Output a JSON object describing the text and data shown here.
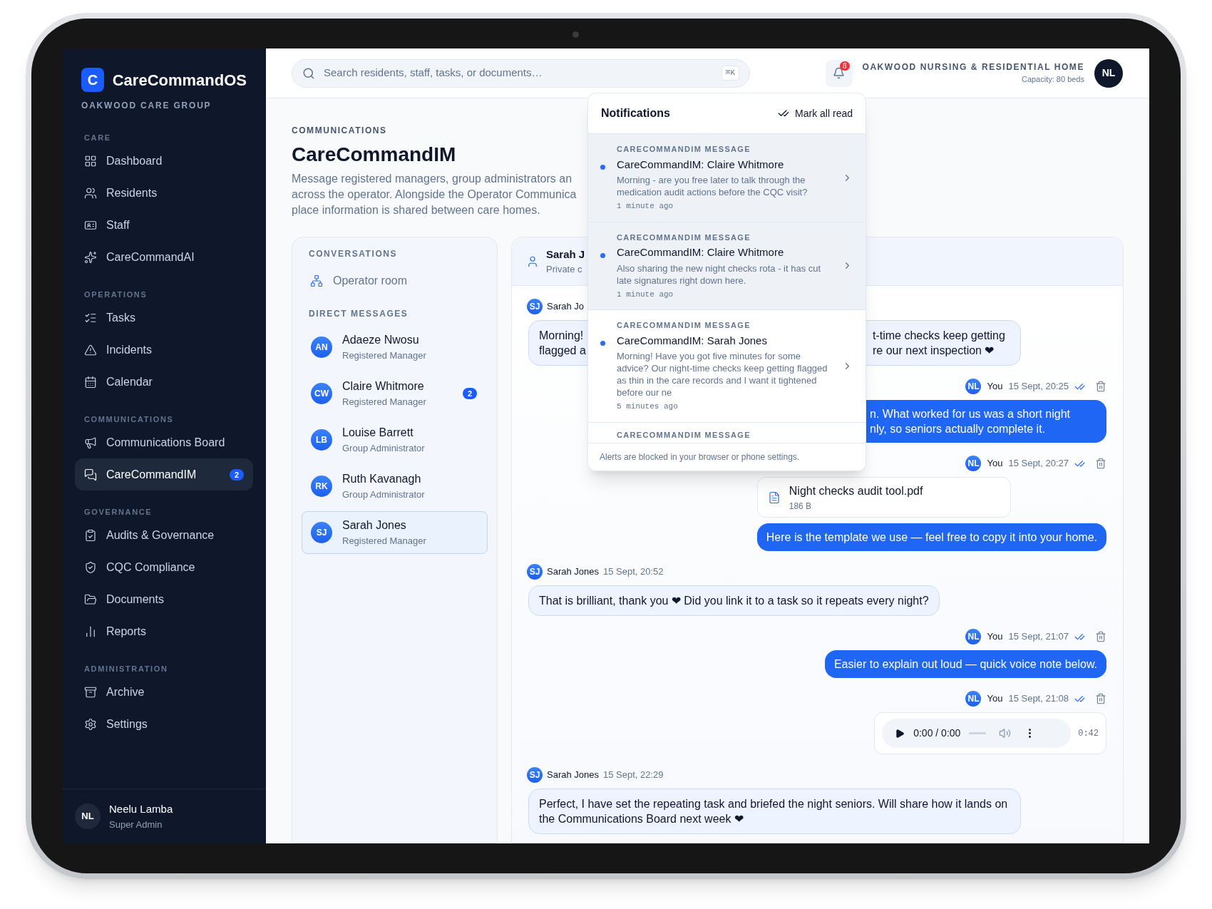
{
  "sidebar": {
    "logo_letter": "C",
    "brand": "CareCommandOS",
    "org": "OAKWOOD CARE GROUP",
    "sections": [
      {
        "title": "CARE",
        "items": [
          {
            "label": "Dashboard",
            "selected": false
          },
          {
            "label": "Residents",
            "selected": false
          },
          {
            "label": "Staff",
            "selected": false
          },
          {
            "label": "CareCommandAI",
            "selected": false
          }
        ]
      },
      {
        "title": "OPERATIONS",
        "items": [
          {
            "label": "Tasks",
            "selected": false
          },
          {
            "label": "Incidents",
            "selected": false
          },
          {
            "label": "Calendar",
            "selected": false
          }
        ]
      },
      {
        "title": "COMMUNICATIONS",
        "items": [
          {
            "label": "Communications Board",
            "selected": false
          },
          {
            "label": "CareCommandIM",
            "selected": true,
            "badge": "2"
          }
        ]
      },
      {
        "title": "GOVERNANCE",
        "items": [
          {
            "label": "Audits & Governance",
            "selected": false
          },
          {
            "label": "CQC Compliance",
            "selected": false
          },
          {
            "label": "Documents",
            "selected": false
          },
          {
            "label": "Reports",
            "selected": false
          }
        ]
      },
      {
        "title": "ADMINISTRATION",
        "items": [
          {
            "label": "Archive",
            "selected": false
          },
          {
            "label": "Settings",
            "selected": false
          }
        ]
      }
    ],
    "user": {
      "initials": "NL",
      "name": "Neelu Lamba",
      "role": "Super Admin"
    }
  },
  "topbar": {
    "search": {
      "placeholder": "Search residents, staff, tasks, or documents…",
      "shortcut": "⌘K"
    },
    "notification_count": "8",
    "home_name": "OAKWOOD NURSING & RESIDENTIAL HOME",
    "capacity": "Capacity: 80 beds",
    "avatar": "NL"
  },
  "page": {
    "breadcrumb": "COMMUNICATIONS",
    "title": "CareCommandIM",
    "description": "Message registered managers, group administrators an\nacross the operator. Alongside the Operator Communica\nplace information is shared between care homes."
  },
  "conversations": {
    "title": "CONVERSATIONS",
    "rooms": [
      {
        "label": "Operator room",
        "selected": false
      }
    ],
    "dm_title": "DIRECT MESSAGES",
    "contacts": [
      {
        "initials": "AN",
        "name": "Adaeze Nwosu",
        "role": "Registered Manager",
        "selected": false
      },
      {
        "initials": "CW",
        "name": "Claire Whitmore",
        "role": "Registered Manager",
        "selected": false,
        "badge": "2"
      },
      {
        "initials": "LB",
        "name": "Louise Barrett",
        "role": "Group Administrator",
        "selected": false
      },
      {
        "initials": "RK",
        "name": "Ruth Kavanagh",
        "role": "Group Administrator",
        "selected": false
      },
      {
        "initials": "SJ",
        "name": "Sarah Jones",
        "role": "Registered Manager",
        "selected": true
      }
    ]
  },
  "chat": {
    "header": {
      "name": "Sarah J",
      "subtitle": "Private c"
    },
    "messages": [
      {
        "kind": "incoming_split",
        "avatar": "SJ",
        "sender": "Sarah Jo",
        "left": "Morning!\nflagged a",
        "right": "t-time checks keep getting\nre our next inspection ❤"
      },
      {
        "kind": "outgoing_clipped",
        "avatar": "NL",
        "sender": "You",
        "time": "15 Sept, 20:25",
        "read": true,
        "text": "n. What worked for us was a short night\nnly, so seniors actually complete it."
      },
      {
        "kind": "outgoing_file",
        "avatar": "NL",
        "sender": "You",
        "time": "15 Sept, 20:27",
        "read": true,
        "file_name": "Night checks audit tool.pdf",
        "file_size": "186 B",
        "text": "Here is the template we use — feel free to copy it into your home."
      },
      {
        "kind": "incoming_text",
        "avatar": "SJ",
        "sender": "Sarah Jones",
        "time": "15 Sept, 20:52",
        "text": "That is brilliant, thank you ❤ Did you link it to a task so it repeats every night?"
      },
      {
        "kind": "outgoing_text",
        "avatar": "NL",
        "sender": "You",
        "time": "15 Sept, 21:07",
        "read": true,
        "text": "Easier to explain out loud — quick voice note below."
      },
      {
        "kind": "outgoing_audio",
        "avatar": "NL",
        "sender": "You",
        "time": "15 Sept, 21:08",
        "read": true,
        "position": "0:00 / 0:00",
        "duration": "0:42"
      },
      {
        "kind": "incoming_text",
        "avatar": "SJ",
        "sender": "Sarah Jones",
        "time": "15 Sept, 22:29",
        "text": "Perfect, I have set the repeating task and briefed the night seniors. Will share how it lands on the Communications Board next week ❤"
      }
    ]
  },
  "notifications": {
    "title": "Notifications",
    "mark_all": "Mark all read",
    "items": [
      {
        "category": "CARECOMMANDIM MESSAGE",
        "title": "CareCommandIM: Claire Whitmore",
        "body": "Morning - are you free later to talk through the medication audit actions before the CQC visit?",
        "time": "1 minute ago",
        "unread": true,
        "highlighted": true
      },
      {
        "category": "CARECOMMANDIM MESSAGE",
        "title": "CareCommandIM: Claire Whitmore",
        "body": "Also sharing the new night checks rota - it has cut late signatures right down here.",
        "time": "1 minute ago",
        "unread": true,
        "highlighted": true
      },
      {
        "category": "CARECOMMANDIM MESSAGE",
        "title": "CareCommandIM: Sarah Jones",
        "body": "Morning! Have you got five minutes for some advice? Our night-time checks keep getting flagged as thin in the care records and I want it tightened before our ne",
        "time": "5 minutes ago",
        "unread": true,
        "highlighted": false
      },
      {
        "category": "CARECOMMANDIM MESSAGE",
        "unread": false,
        "highlighted": false
      }
    ],
    "footer": "Alerts are blocked in your browser or phone settings."
  }
}
